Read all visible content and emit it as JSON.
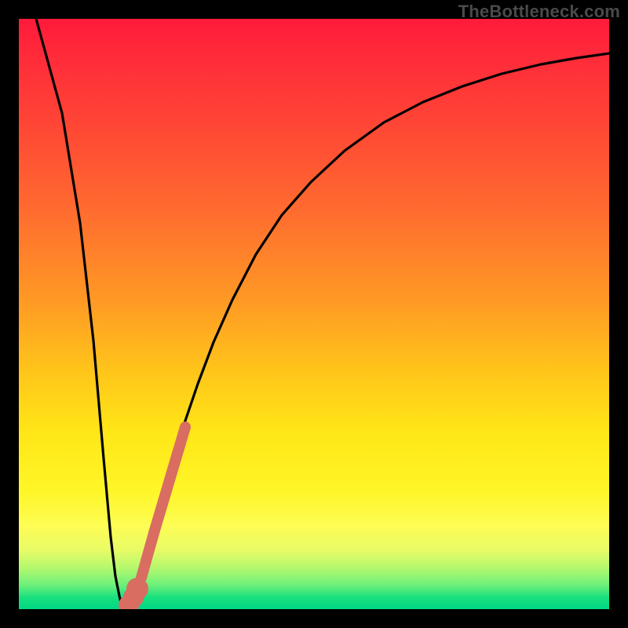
{
  "watermark": "TheBottleneck.com",
  "chart_data": {
    "type": "line",
    "title": "",
    "xlabel": "",
    "ylabel": "",
    "xlim": [
      0,
      100
    ],
    "ylim": [
      0,
      100
    ],
    "series": [
      {
        "name": "bottleneck-curve",
        "x": [
          3,
          5,
          7,
          9,
          11,
          12.5,
          13.5,
          14,
          14.5,
          15,
          15.5,
          16,
          16.5,
          17,
          18,
          19,
          20,
          21,
          22,
          23,
          25,
          27,
          30,
          33,
          36,
          40,
          45,
          50,
          55,
          60,
          67,
          75,
          83,
          91,
          100
        ],
        "values": [
          100,
          85,
          70,
          55,
          38,
          22,
          12,
          6,
          2,
          0,
          0,
          0.5,
          1,
          2,
          5,
          9,
          13,
          17,
          22,
          26,
          33,
          40,
          48,
          55,
          60,
          66,
          72,
          76,
          80,
          83,
          86,
          89,
          91,
          93,
          94
        ]
      }
    ],
    "highlight_segment": {
      "name": "highlighted-range",
      "color": "#d96d62",
      "points": [
        {
          "x": 18.2,
          "y": 2.0
        },
        {
          "x": 18.8,
          "y": 3.0
        },
        {
          "x": 19.6,
          "y": 4.6
        },
        {
          "x": 20.5,
          "y": 7.4
        },
        {
          "x": 23.0,
          "y": 15.0
        },
        {
          "x": 28.0,
          "y": 31.0
        }
      ]
    },
    "gradient_stops": [
      {
        "pos": 0,
        "color": "#ff1a3a"
      },
      {
        "pos": 50,
        "color": "#ffb020"
      },
      {
        "pos": 80,
        "color": "#fff030"
      },
      {
        "pos": 100,
        "color": "#00d884"
      }
    ]
  }
}
